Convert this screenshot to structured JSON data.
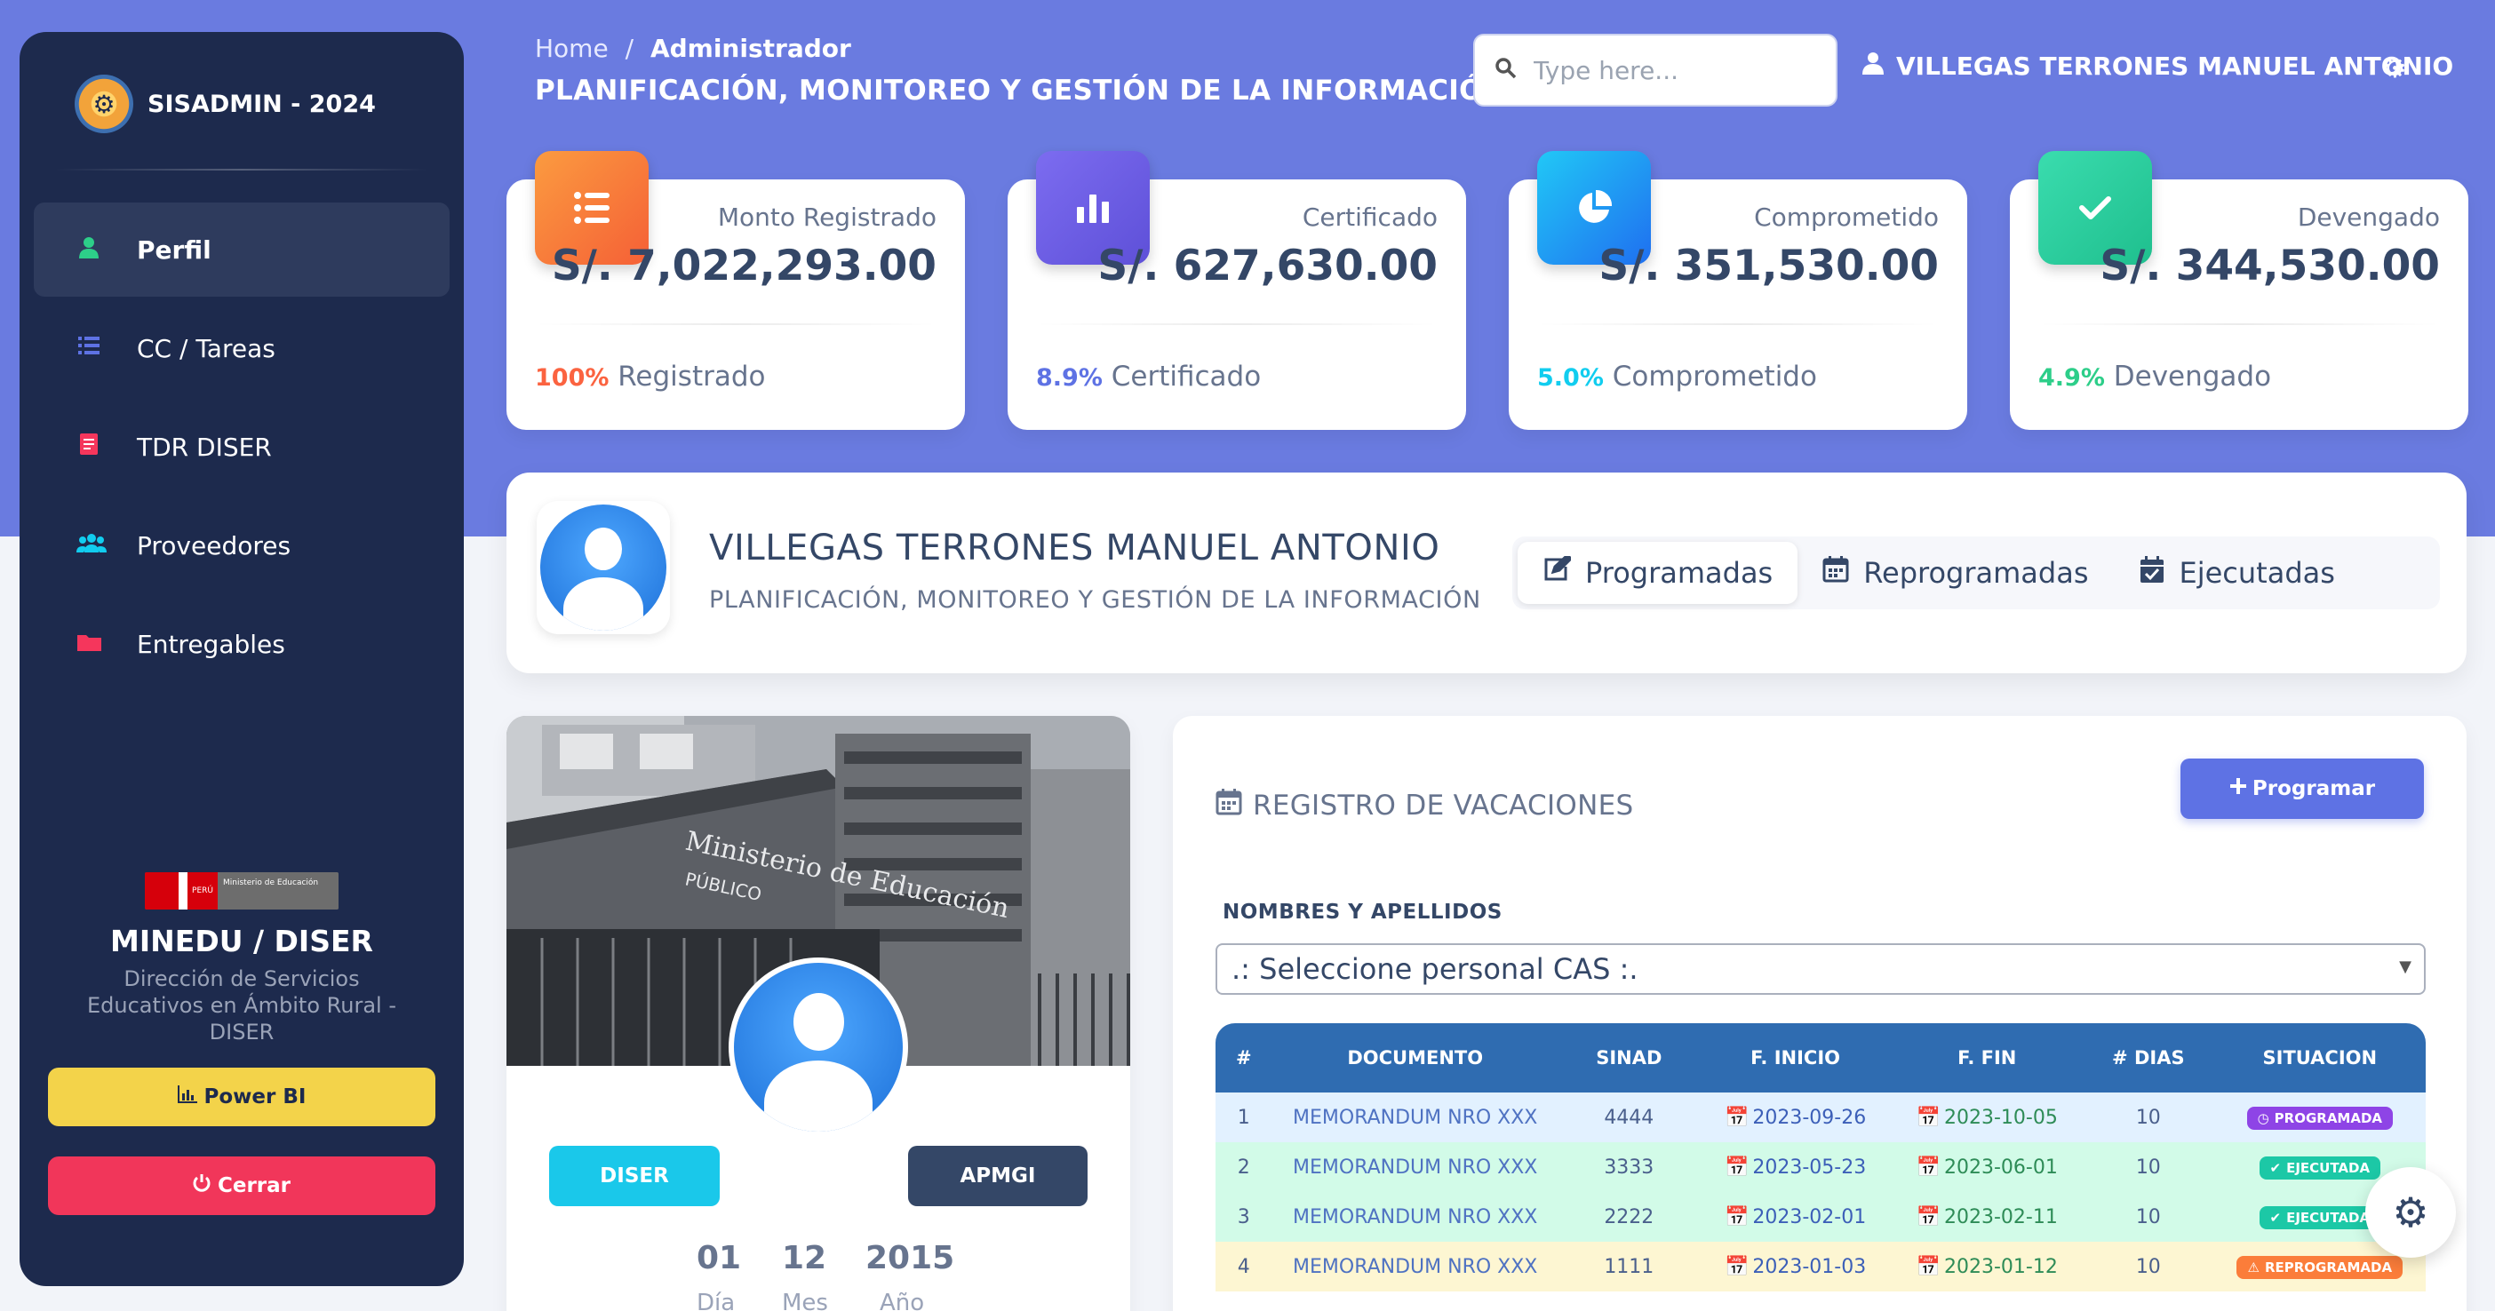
{
  "sidebar": {
    "brand": "SISADMIN - 2024",
    "items": [
      {
        "label": "Perfil",
        "icon": "user-icon",
        "color": "#2dce89"
      },
      {
        "label": "CC / Tareas",
        "icon": "list-icon",
        "color": "#5e72e4"
      },
      {
        "label": "TDR DISER",
        "icon": "document-icon",
        "color": "#f5365c"
      },
      {
        "label": "Proveedores",
        "icon": "users-icon",
        "color": "#11cdef"
      },
      {
        "label": "Entregables",
        "icon": "folder-icon",
        "color": "#f5365c"
      }
    ],
    "flag_country": "PERÚ",
    "flag_ministry": "Ministerio de Educación",
    "org_name": "MINEDU / DISER",
    "org_desc": "Dirección de Servicios Educativos en Ámbito Rural - DISER",
    "powerbi_label": "Power BI",
    "logout_label": "Cerrar"
  },
  "header": {
    "crumb_home": "Home",
    "crumb_sep": "/",
    "crumb_current": "Administrador",
    "title": "PLANIFICACIÓN, MONITOREO Y GESTIÓN DE LA INFORMACIÓN",
    "search_placeholder": "Type here...",
    "user_name": "VILLEGAS TERRONES MANUEL ANTONIO"
  },
  "stats": [
    {
      "label": "Monto Registrado",
      "value": "S/. 7,022,293.00",
      "pct": "100%",
      "foot": "Registrado",
      "pct_color": "#fb6340",
      "icon": "list-icon"
    },
    {
      "label": "Certificado",
      "value": "S/. 627,630.00",
      "pct": "8.9%",
      "foot": "Certificado",
      "pct_color": "#5e72e4",
      "icon": "bar-chart-icon"
    },
    {
      "label": "Comprometido",
      "value": "S/. 351,530.00",
      "pct": "5.0%",
      "foot": "Comprometido",
      "pct_color": "#11cdef",
      "icon": "pie-chart-icon"
    },
    {
      "label": "Devengado",
      "value": "S/. 344,530.00",
      "pct": "4.9%",
      "foot": "Devengado",
      "pct_color": "#2dce89",
      "icon": "check-icon"
    }
  ],
  "profile": {
    "name": "VILLEGAS TERRONES MANUEL ANTONIO",
    "dept": "PLANIFICACIÓN, MONITOREO Y GESTIÓN DE LA INFORMACIÓN",
    "tabs": [
      "Programadas",
      "Reprogramadas",
      "Ejecutadas"
    ]
  },
  "left_card": {
    "building_sign_1": "Ministerio de Educación",
    "building_sign_2": "PÚBLICO",
    "btn_left": "DISER",
    "btn_right": "APMGI",
    "day": "01",
    "day_label": "Día",
    "month": "12",
    "month_label": "Mes",
    "year": "2015",
    "year_label": "Año"
  },
  "vacations": {
    "title": "REGISTRO DE VACACIONES",
    "program_button": "Programar",
    "field_label": "NOMBRES Y APELLIDOS",
    "select_value": ".: Seleccione personal CAS :.",
    "columns": [
      "#",
      "DOCUMENTO",
      "SINAD",
      "F. INICIO",
      "F. FIN",
      "# DIAS",
      "SITUACION"
    ],
    "rows": [
      {
        "n": "1",
        "doc": "MEMORANDUM NRO XXX",
        "sinad": "4444",
        "start": "2023-09-26",
        "end": "2023-10-05",
        "days": "10",
        "status": "PROGRAMADA",
        "status_color": "#8e44e6"
      },
      {
        "n": "2",
        "doc": "MEMORANDUM NRO XXX",
        "sinad": "3333",
        "start": "2023-05-23",
        "end": "2023-06-01",
        "days": "10",
        "status": "EJECUTADA",
        "status_color": "#1cc8a6"
      },
      {
        "n": "3",
        "doc": "MEMORANDUM NRO XXX",
        "sinad": "2222",
        "start": "2023-02-01",
        "end": "2023-02-11",
        "days": "10",
        "status": "EJECUTADA",
        "status_color": "#1cc8a6"
      },
      {
        "n": "4",
        "doc": "MEMORANDUM NRO XXX",
        "sinad": "1111",
        "start": "2023-01-03",
        "end": "2023-01-12",
        "days": "10",
        "status": "REPROGRAMADA",
        "status_color": "#fb7d3a"
      }
    ]
  }
}
